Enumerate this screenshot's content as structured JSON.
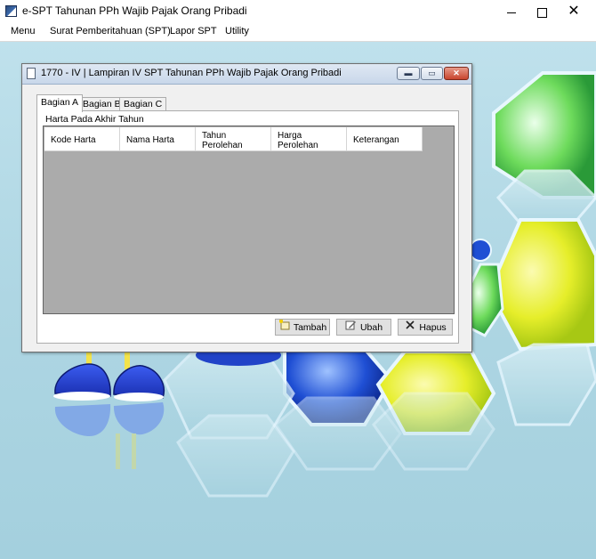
{
  "app": {
    "title": "e-SPT Tahunan PPh Wajib Pajak Orang Pribadi",
    "controls": {
      "minimize": "",
      "maximize": "",
      "close": "✕"
    }
  },
  "menubar": {
    "items": [
      "Menu",
      "Surat Pemberitahuan (SPT)",
      "Lapor SPT",
      "Utility"
    ]
  },
  "dialog": {
    "title": "1770 - IV | Lampiran IV SPT Tahunan PPh Wajib Pajak Orang Pribadi",
    "controls": {
      "minimize": "▬",
      "maximize": "▭",
      "close": "✕"
    },
    "tabs": [
      "Bagian A",
      "Bagian B",
      "Bagian C"
    ],
    "active_tab": "Bagian A",
    "group_label": "Harta Pada Akhir Tahun",
    "table": {
      "columns": [
        [
          "Kode Harta"
        ],
        [
          "Nama Harta"
        ],
        [
          "Tahun",
          "Perolehan"
        ],
        [
          "Harga",
          "Perolehan"
        ],
        [
          "Keterangan"
        ]
      ],
      "rows": []
    },
    "buttons": {
      "tambah": "Tambah",
      "ubah": "Ubah",
      "hapus": "Hapus"
    },
    "button_icons": {
      "tambah": "add-record-icon",
      "ubah": "edit-pencil-icon",
      "hapus": "delete-x-icon"
    }
  },
  "colors": {
    "desktop_bg": "#aed6e3",
    "grid_bg": "#ababab",
    "dialog_title_bg": "#c8d7ea",
    "close_red": "#c8442d"
  }
}
